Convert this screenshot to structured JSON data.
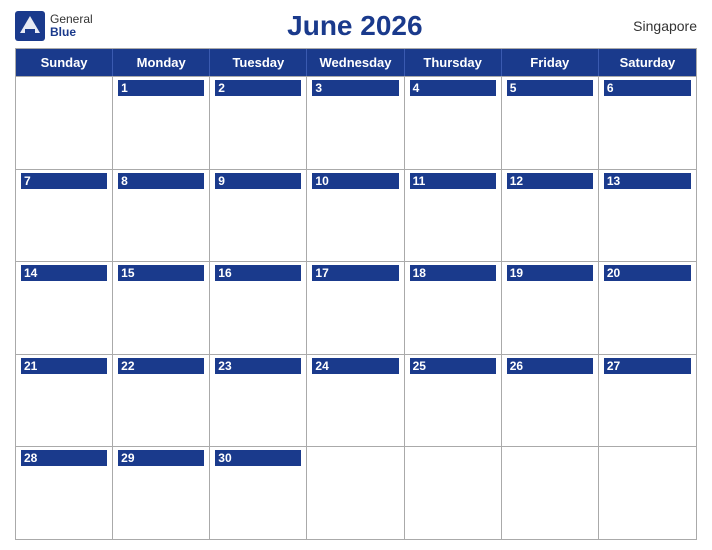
{
  "header": {
    "logo_general": "General",
    "logo_blue": "Blue",
    "title": "June 2026",
    "location": "Singapore"
  },
  "calendar": {
    "day_headers": [
      "Sunday",
      "Monday",
      "Tuesday",
      "Wednesday",
      "Thursday",
      "Friday",
      "Saturday"
    ],
    "weeks": [
      [
        {
          "num": "",
          "active": false
        },
        {
          "num": "1",
          "active": true
        },
        {
          "num": "2",
          "active": true
        },
        {
          "num": "3",
          "active": true
        },
        {
          "num": "4",
          "active": true
        },
        {
          "num": "5",
          "active": true
        },
        {
          "num": "6",
          "active": true
        }
      ],
      [
        {
          "num": "7",
          "active": true
        },
        {
          "num": "8",
          "active": true
        },
        {
          "num": "9",
          "active": true
        },
        {
          "num": "10",
          "active": true
        },
        {
          "num": "11",
          "active": true
        },
        {
          "num": "12",
          "active": true
        },
        {
          "num": "13",
          "active": true
        }
      ],
      [
        {
          "num": "14",
          "active": true
        },
        {
          "num": "15",
          "active": true
        },
        {
          "num": "16",
          "active": true
        },
        {
          "num": "17",
          "active": true
        },
        {
          "num": "18",
          "active": true
        },
        {
          "num": "19",
          "active": true
        },
        {
          "num": "20",
          "active": true
        }
      ],
      [
        {
          "num": "21",
          "active": true
        },
        {
          "num": "22",
          "active": true
        },
        {
          "num": "23",
          "active": true
        },
        {
          "num": "24",
          "active": true
        },
        {
          "num": "25",
          "active": true
        },
        {
          "num": "26",
          "active": true
        },
        {
          "num": "27",
          "active": true
        }
      ],
      [
        {
          "num": "28",
          "active": true
        },
        {
          "num": "29",
          "active": true
        },
        {
          "num": "30",
          "active": true
        },
        {
          "num": "",
          "active": false
        },
        {
          "num": "",
          "active": false
        },
        {
          "num": "",
          "active": false
        },
        {
          "num": "",
          "active": false
        }
      ]
    ]
  }
}
